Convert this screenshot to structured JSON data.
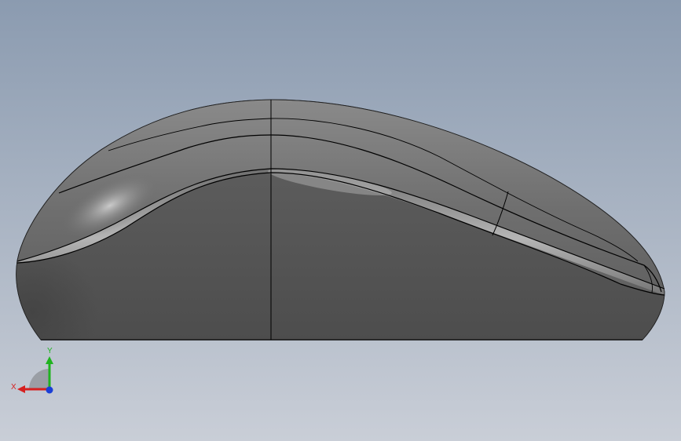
{
  "viewport": {
    "background_top": "#8b9bb0",
    "background_bottom": "#c9ced7"
  },
  "model": {
    "name": "computer-mouse",
    "body_color": "#5e5e5e",
    "highlight_color": "#c8c8c8",
    "edge_color": "#000000"
  },
  "triad": {
    "x_label": "X",
    "y_label": "Y",
    "x_color": "#d62020",
    "y_color": "#1fb31f",
    "z_color": "#1a3fd6"
  }
}
